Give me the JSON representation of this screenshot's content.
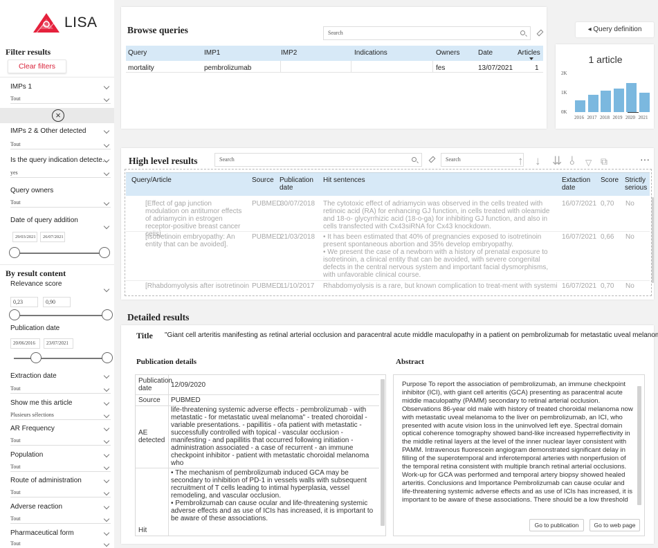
{
  "app": {
    "logo_text": "LISA",
    "brand_color": "#e5213c",
    "accent_color": "#d7e9f7",
    "bar_color": "#7bb8df"
  },
  "sidebar": {
    "filter_heading": "Filter results",
    "clear_filters": "Clear filters",
    "filters_top": [
      {
        "label": "IMPs 1",
        "value": "Tout"
      },
      {
        "label": "IMPs 2 & Other detected",
        "value": "Tout"
      },
      {
        "label": "Is the query indication detecte...",
        "value": "yes"
      },
      {
        "label": "Query owners",
        "value": "Tout"
      }
    ],
    "date_of_query_addition": {
      "label": "Date of query addition",
      "from": "29/03/2021",
      "to": "26/07/2021"
    },
    "by_result_heading": "By result content",
    "relevance": {
      "label": "Relevance score",
      "min": "0,23",
      "max": "0,90"
    },
    "publication_date": {
      "label": "Publication date",
      "from": "20/06/2016",
      "to": "23/07/2021"
    },
    "filters_bottom": [
      {
        "label": "Extraction date",
        "value": "Tout"
      },
      {
        "label": "Show me this article",
        "value": "Plusieurs sélections"
      },
      {
        "label": "AR Frequency",
        "value": "Tout"
      },
      {
        "label": "Population",
        "value": "Tout"
      },
      {
        "label": "Route of administration",
        "value": "Tout"
      },
      {
        "label": "Adverse reaction",
        "value": "Tout"
      },
      {
        "label": "Pharmaceutical form",
        "value": "Tout"
      }
    ]
  },
  "browse": {
    "title": "Browse queries",
    "search_placeholder": "Search",
    "query_definition_btn": "◂ Query definition",
    "columns": [
      "Query",
      "IMP1",
      "IMP2",
      "Indications",
      "Owners",
      "Date",
      "Articles"
    ],
    "rows": [
      {
        "query": "mortality",
        "imp1": "pembrolizumab",
        "imp2": "",
        "indications": "",
        "owners": "fes",
        "date": "13/07/2021",
        "articles": "1"
      }
    ]
  },
  "chart_data": {
    "type": "bar",
    "title": "1 article",
    "categories": [
      "2016",
      "2017",
      "2018",
      "2019",
      "2020",
      "2021"
    ],
    "values": [
      0.6,
      0.9,
      1.1,
      1.2,
      1.5,
      1.0
    ],
    "ylim": [
      0,
      2
    ],
    "yticks": [
      "0K",
      "1K",
      "2K"
    ],
    "grid": false
  },
  "high_level": {
    "title": "High level results",
    "search_placeholder": "Search",
    "search2_placeholder": "Search",
    "columns": [
      "Query/Article",
      "Source",
      "Publication date",
      "Hit sentences",
      "Extaction date",
      "Score",
      "Strictly serious"
    ],
    "rows": [
      {
        "article": "[Effect of gap junction modulation on antitumor effects of adriamycin in estrogen receptor-positive breast cancer cells].",
        "source": "PUBMED",
        "pub_date": "30/07/2018",
        "hits": "The cytotoxic effect of adriamycin was observed in the cells treated with retinoic acid (RA) for enhancing GJ function, in cells treated with oleamide and 18-o- glycyrrhizic acid (18-o-ga) for inhibiting GJ function, and also in cells transfected with Cx43siRNA for Cx43 knockdown.",
        "extraction": "16/07/2021",
        "score": "0,70",
        "serious": "No"
      },
      {
        "article": "[Isotretinoin embryopathy: An entity that can be avoided].",
        "source": "PUBMED",
        "pub_date": "21/03/2018",
        "hits": "• It has been estimated that 40% of pregnancies exposed to isotretinoin present spontaneous abortion and 35% develop embryopathy.\n• We present the case of a newborn with a history of prenatal exposure to isotretinoin, a clinical entity that can be avoided, with severe congenital defects in the central nervous system and important facial dysmorphisms, with unfavorable clinical course.",
        "extraction": "16/07/2021",
        "score": "0,66",
        "serious": "No"
      },
      {
        "article": "[Rhabdomyolysis after isotretinoin",
        "source": "PUBMED",
        "pub_date": "11/10/2017",
        "hits": "Rhabdomyolysis is a rare, but known complication to treat-ment with systemic",
        "extraction": "16/07/2021",
        "score": "0,70",
        "serious": "No"
      }
    ]
  },
  "detailed": {
    "title": "Detailed results",
    "title_label": "Title",
    "title_value": "\"Giant cell arteritis manifesting as retinal arterial occlusion and paracentral acute middle maculopathy in a patient on pembrolizumab for metastatic uveal melanoma\".",
    "pub_details_heading": "Publication details",
    "abstract_heading": "Abstract",
    "pub_details": {
      "publication_date_label": "Publication date",
      "publication_date": "12/09/2020",
      "source_label": "Source",
      "source": "PUBMED",
      "ae_label": "AE detected",
      "ae": "life-threatening systemic adverse effects - pembrolizumab - with metastatic - for metastatic uveal melanoma\" - treated choroidal - variable presentations. - papillitis - ofa patient with metastatic - successfully controlled with topical - vascular occlusion - manifesting - and papillitis that occurred following initiation - administration associated - a case of recurrent - an immune checkpoint inhibitor - patient with metastatic choroidal melanoma who",
      "hit_label": "Hit",
      "hit": "• The mechanism of pembrolizumab induced GCA may be secondary to inhibition of PD-1 in vessels walls with subsequent recruitment of T cells leading to intimal hyperplasia, vessel remodeling, and vascular occlusion.\n• Pembrolizumab can cause ocular and life-threatening systemic adverse effects and as use of ICIs has increased, it is important to be aware of these associations."
    },
    "abstract": "Purpose To report the association of pembrolizumab, an immune checkpoint inhibitor (ICI), with giant cell arteritis (GCA) presenting as paracentral acute middle maculopathy (PAMM) secondary to retinal arterial occlusion. Observations 86-year old male with history of treated choroidal melanoma now with metastatic uveal melanoma to the liver on pembrolizumab, an ICI, who presented with acute vision loss in the uninvolved left eye. Spectral domain optical coherence tomography showed band-like increased hyperreflectivity in the middle retinal layers at the level of the inner nuclear layer consistent with PAMM. Intravenous fluorescein angiogram demonstrated significant delay in filling of the superotemporal and inferotemporal arteries with nonperfusion of the temporal retina consistent with multiple branch retinal arterial occlusions. Work-up for GCA was performed and temporal artery biopsy showed healed arteritis. Conclusions and Importance Pembrolizumab can cause ocular and life-threatening systemic adverse effects and as use of ICIs has increased, it is important to be aware of these associations. There should be a low threshold",
    "go_publication": "Go to publication",
    "go_web": "Go to web page"
  }
}
